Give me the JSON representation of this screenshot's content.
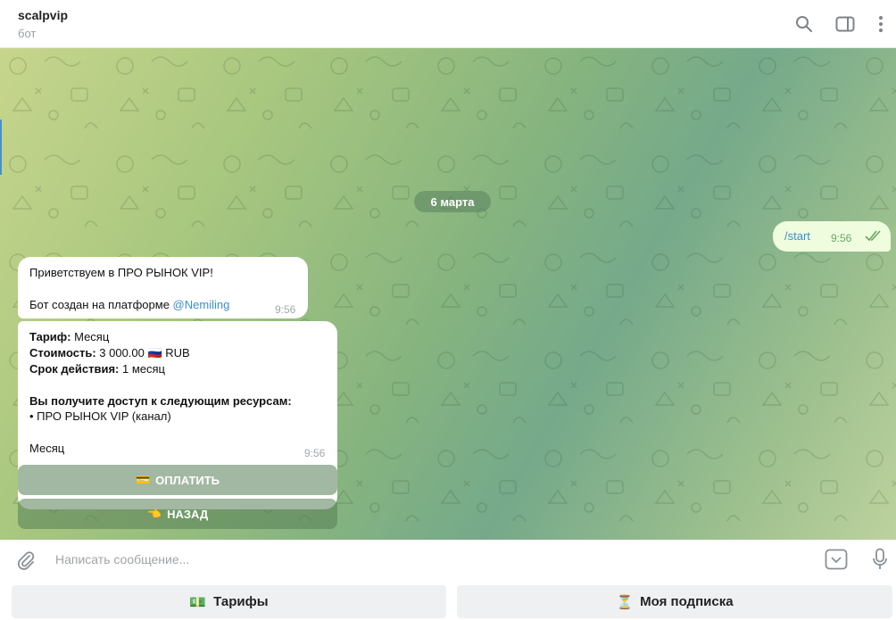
{
  "header": {
    "title": "scalpvip",
    "subtitle": "бот",
    "icons": [
      "search-icon",
      "sidebar-toggle-icon",
      "more-vertical-icon"
    ]
  },
  "chat": {
    "date_label": "6 марта",
    "outgoing": {
      "text": "/start",
      "time": "9:56",
      "status": "read"
    },
    "message1": {
      "line1": "Приветствуем в ПРО РЫНОК VIP!",
      "line2_prefix": "Бот создан на платформе ",
      "mention": "@Nemiling",
      "time": "9:56"
    },
    "message2": {
      "tariff_label": "Тариф:",
      "tariff_value": " Месяц",
      "price_label": "Стоимость:",
      "price_value": " 3 000.00 ",
      "price_flag": "🇷🇺",
      "price_currency": " RUB",
      "period_label": "Срок действия:",
      "period_value": " 1 месяц",
      "resources_label": "Вы получите доступ к следующим ресурсам:",
      "resource_item": "• ПРО РЫНОК VIP (канал)",
      "footer": "Месяц",
      "time": "9:56"
    },
    "inline_buttons": [
      {
        "emoji": "💳",
        "label": "ОПЛАТИТЬ"
      },
      {
        "emoji": "👈",
        "label": "НАЗАД"
      }
    ]
  },
  "composer": {
    "placeholder": "Написать сообщение..."
  },
  "reply_keyboard": [
    {
      "emoji": "💵",
      "label": "Тарифы"
    },
    {
      "emoji": "⏳",
      "label": "Моя подписка"
    }
  ],
  "colors": {
    "link": "#3a8fd0",
    "outgoing_bubble": "#effdde",
    "read_ticks": "#6aa564"
  }
}
